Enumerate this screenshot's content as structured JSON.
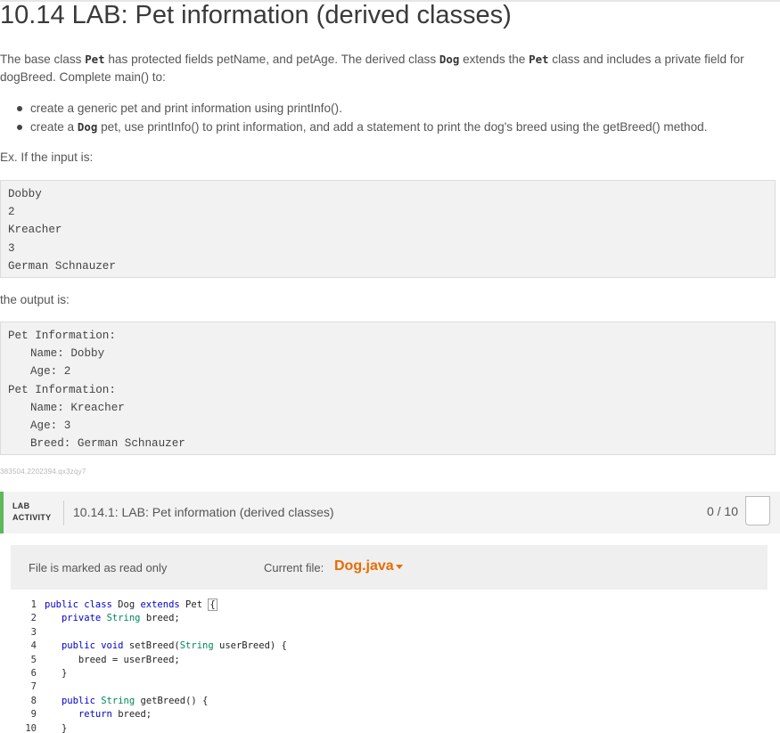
{
  "page": {
    "title": "10.14 LAB: Pet information (derived classes)"
  },
  "intro": {
    "p1": "The base class ",
    "c1": "Pet",
    "p2": " has protected fields petName, and petAge. The derived class ",
    "c2": "Dog",
    "p3": " extends the ",
    "c3": "Pet",
    "p4": " class and includes a private field for",
    "line2": "dogBreed. Complete main() to:"
  },
  "bullets": {
    "b1": "create a generic pet and print information using printInfo().",
    "b2_pre": "create a ",
    "b2_code": "Dog",
    "b2_post": " pet, use printInfo() to print information, and add a statement to print the dog's breed using the getBreed() method."
  },
  "example": {
    "if_input": "Ex. If the input is:",
    "input_lines": [
      "Dobby",
      "2",
      "Kreacher",
      "3",
      "German Schnauzer"
    ],
    "output_label": "the output is:",
    "output_lines": [
      {
        "text": "Pet Information:",
        "indent": false
      },
      {
        "text": "Name: Dobby",
        "indent": true
      },
      {
        "text": "Age: 2",
        "indent": true
      },
      {
        "text": "Pet Information:",
        "indent": false
      },
      {
        "text": "Name: Kreacher",
        "indent": true
      },
      {
        "text": "Age: 3",
        "indent": true
      },
      {
        "text": "Breed: German Schnauzer",
        "indent": true
      }
    ]
  },
  "tracking_id": "383504.2202394.qx3zqy7",
  "lab": {
    "tag_line1": "LAB",
    "tag_line2": "ACTIVITY",
    "name": "10.14.1: LAB: Pet information (derived classes)",
    "score": "0 / 10"
  },
  "editor": {
    "readonly_text": "File is marked as read only",
    "current_file_label": "Current file:",
    "current_file": "Dog.java",
    "line_numbers": [
      "1",
      "2",
      "3",
      "4",
      "5",
      "6",
      "7",
      "8",
      "9",
      "10"
    ]
  },
  "colors": {
    "accent_orange": "#e86c00",
    "lab_green": "#5cb85c"
  }
}
